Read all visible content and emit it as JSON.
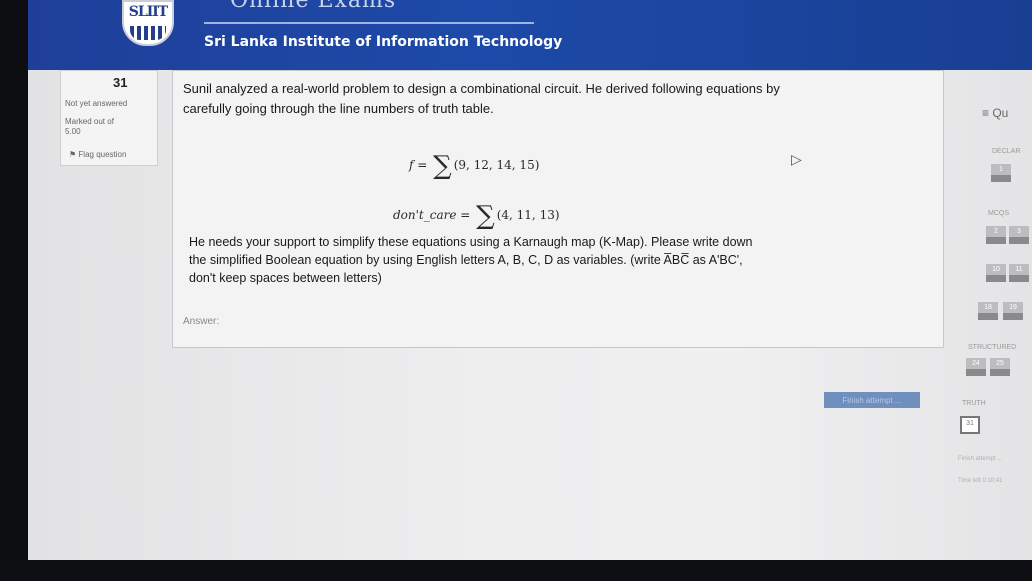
{
  "header": {
    "logo_text": "SLIIT",
    "banner_title": "Online Exams",
    "institute": "Sri Lanka Institute of Information Technology"
  },
  "question_info": {
    "number": "31",
    "status": "Not yet answered",
    "marked_out_of": "Marked out of",
    "marks": "5.00",
    "flag_label": "Flag question"
  },
  "question": {
    "intro": "Sunil analyzed a real-world problem to design a combinational circuit. He derived following equations by carefully going through the line numbers of truth table.",
    "eq1_lhs": "f = ",
    "eq1_sigma": "∑",
    "eq1_terms": "(9, 12, 14, 15)",
    "eq2_lhs": "don't_care = ",
    "eq2_sigma": "∑",
    "eq2_terms": "(4, 11, 13)",
    "instruction": "He needs your support to simplify these equations using a Karnaugh map (K-Map). Please write down the simplified Boolean equation by using English letters A, B, C, D as variables. (write A̅BC̅ as A'BC', don't keep spaces between letters)",
    "answer_label": "Answer:",
    "answer_value": ""
  },
  "navigation": {
    "title": "≡ Qu",
    "sections": [
      {
        "label": "DECLAR",
        "buttons": [
          "1"
        ]
      },
      {
        "label": "MCQS",
        "buttons": [
          "2",
          "3"
        ]
      },
      {
        "label": "",
        "buttons": [
          "10",
          "11"
        ]
      },
      {
        "label": "",
        "buttons": [
          "18",
          "19"
        ]
      },
      {
        "label": "STRUCTURED",
        "buttons": [
          "24",
          "25"
        ]
      },
      {
        "label": "TRUTH",
        "buttons": [
          "31"
        ]
      }
    ],
    "finish_attempt": "Finish attempt ...",
    "finish_link": "Finish attempt ...",
    "time_left": "Time left 0:10:41"
  },
  "colors": {
    "header_blue": "#1d4aa8",
    "finish_button": "#6f8fbf"
  },
  "icons": [
    "flag-icon",
    "cursor-icon",
    "menu-icon"
  ]
}
